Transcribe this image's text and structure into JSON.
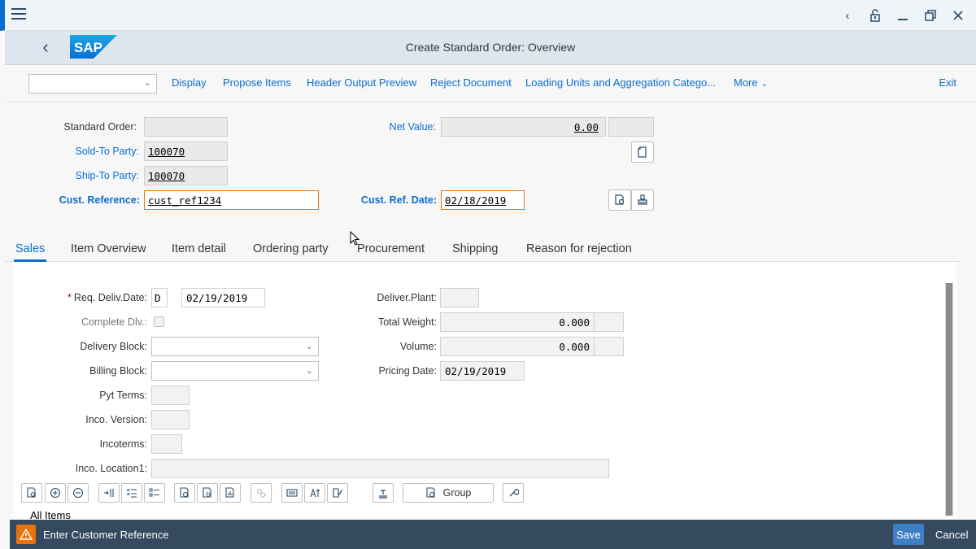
{
  "shell": {
    "icons": [
      "chevron-left-icon",
      "unlock-icon",
      "minimize-icon",
      "restore-icon",
      "close-icon"
    ]
  },
  "titlebar": {
    "logo_text": "SAP",
    "title": "Create Standard Order: Overview"
  },
  "toolbar": {
    "select_value": "",
    "buttons": [
      "Display",
      "Propose Items",
      "Header Output Preview",
      "Reject Document",
      "Loading Units and Aggregation Catego..."
    ],
    "more": "More",
    "exit": "Exit"
  },
  "header": {
    "standard_order_label": "Standard Order:",
    "standard_order_value": "",
    "net_value_label": "Net Value:",
    "net_value": "0.00",
    "currency": "",
    "sold_to_label": "Sold-To Party:",
    "sold_to_value": "100070",
    "ship_to_label": "Ship-To Party:",
    "ship_to_value": "100070",
    "cust_ref_label": "Cust. Reference:",
    "cust_ref_value": "cust_ref1234",
    "cust_ref_date_label": "Cust. Ref. Date:",
    "cust_ref_date_value": "02/18/2019"
  },
  "tabs": [
    "Sales",
    "Item Overview",
    "Item detail",
    "Ordering party",
    "Procurement",
    "Shipping",
    "Reason for rejection"
  ],
  "sales": {
    "req_deliv_date_label": "Req. Deliv.Date:",
    "req_deliv_type": "D",
    "req_deliv_date": "02/19/2019",
    "complete_dlv_label": "Complete Dlv.:",
    "delivery_block_label": "Delivery Block:",
    "billing_block_label": "Billing Block:",
    "pyt_terms_label": "Pyt Terms:",
    "inco_version_label": "Inco. Version:",
    "incoterms_label": "Incoterms:",
    "inco_location_label": "Inco. Location1:",
    "deliver_plant_label": "Deliver.Plant:",
    "total_weight_label": "Total Weight:",
    "total_weight_value": "0.000",
    "volume_label": "Volume:",
    "volume_value": "0.000",
    "pricing_date_label": "Pricing Date:",
    "pricing_date_value": "02/19/2019"
  },
  "items": {
    "group_label": "Group",
    "all_items_label": "All Items"
  },
  "footer": {
    "message": "Enter Customer Reference",
    "save": "Save",
    "cancel": "Cancel"
  }
}
